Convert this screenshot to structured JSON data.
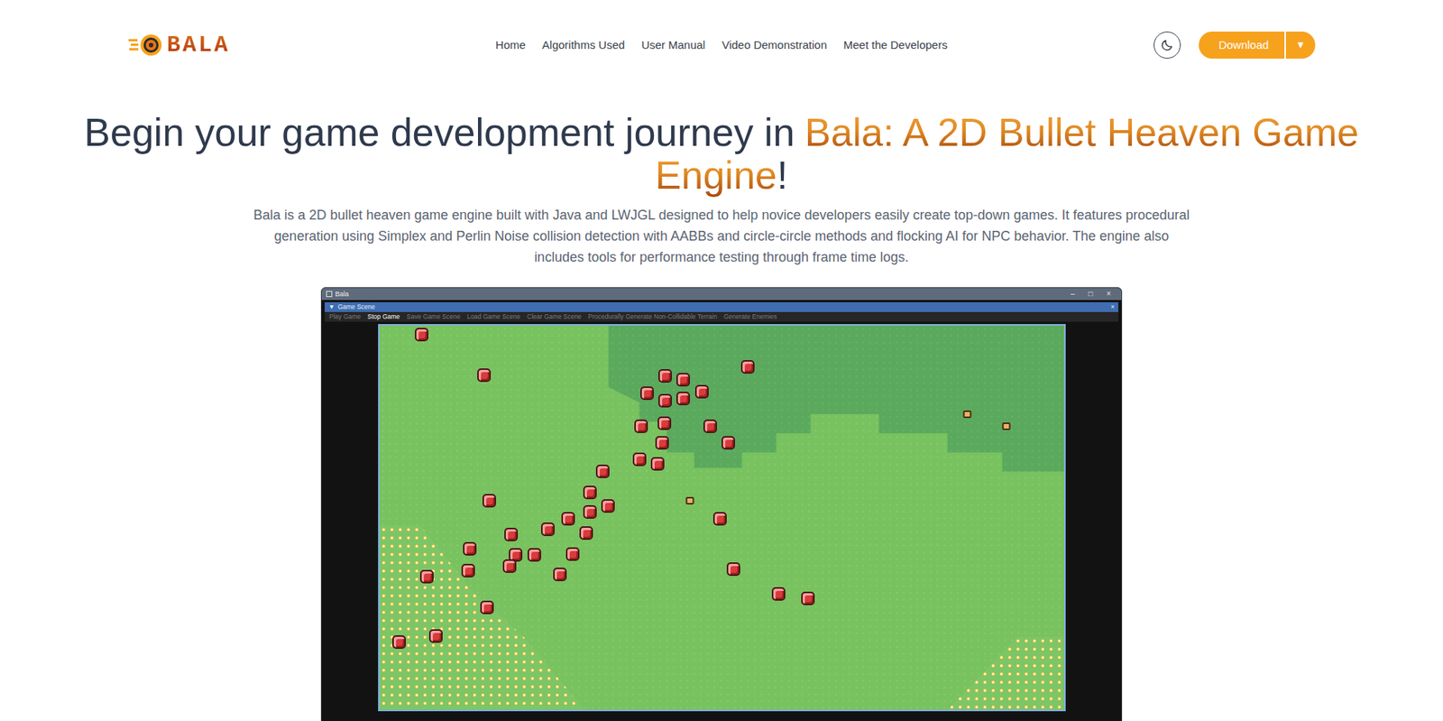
{
  "logo": {
    "text": "BALA"
  },
  "nav": {
    "items": [
      "Home",
      "Algorithms Used",
      "User Manual",
      "Video Demonstration",
      "Meet the Developers"
    ]
  },
  "download": {
    "label": "Download",
    "caret": "▼"
  },
  "hero": {
    "title_start": "Begin your game development journey in",
    "title_highlight": "Bala: A 2D Bullet Heaven Game Engine",
    "title_end": "!",
    "description": "Bala is a 2D bullet heaven game engine built with Java and LWJGL designed to help novice developers easily create top-down games. It features procedural generation using Simplex and Perlin Noise collision detection with AABBs and circle-circle methods and flocking AI for NPC behavior. The engine also includes tools for performance testing through frame time logs."
  },
  "app_window": {
    "title": "Bala",
    "controls": [
      "–",
      "□",
      "×"
    ],
    "panel": {
      "arrow": "▼",
      "title": "Game Scene",
      "close": "×"
    },
    "menu": [
      {
        "label": "Play Game",
        "selected": false
      },
      {
        "label": "Stop Game",
        "selected": true
      },
      {
        "label": "Save Game Scene",
        "selected": false
      },
      {
        "label": "Load Game Scene",
        "selected": false
      },
      {
        "label": "Clear Game Scene",
        "selected": false
      },
      {
        "label": "Procedurally Generate Non-Collidable Terrain",
        "selected": false
      },
      {
        "label": "Generate Enemies",
        "selected": false
      }
    ]
  }
}
